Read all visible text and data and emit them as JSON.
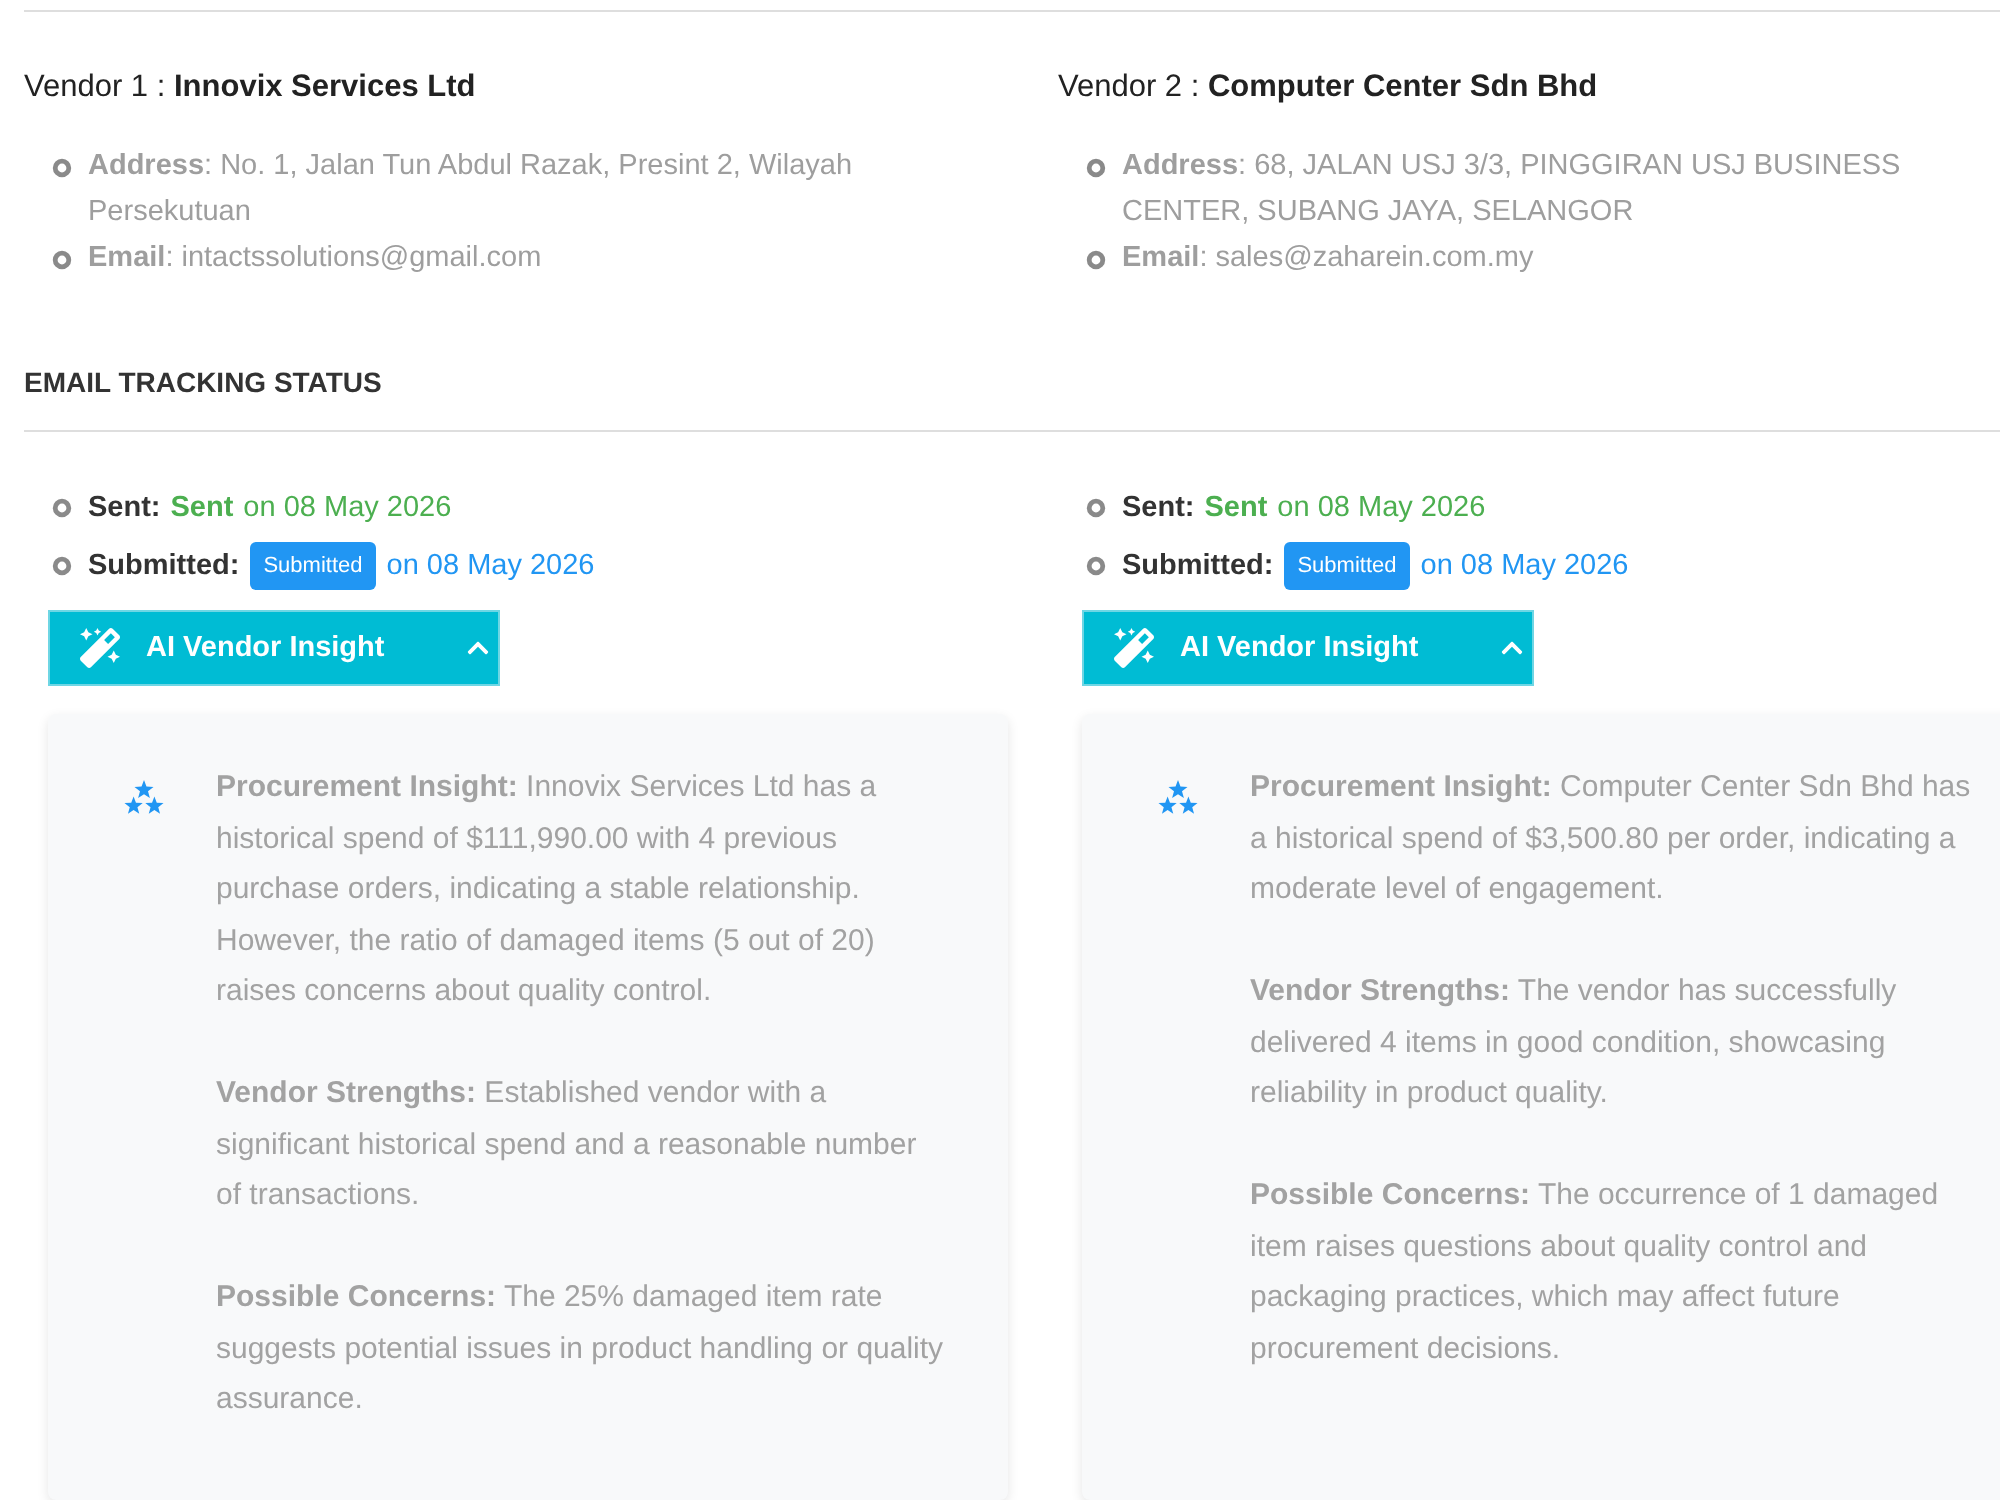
{
  "vendors": [
    {
      "title": "Vendor 1 : **Innovix Services Ltd**",
      "details": [
        "**Address**: No. 1, Jalan Tun Abdul Razak, Presint 2, Wilayah Persekutuan",
        "**Email**: intactssolutions@gmail.com"
      ]
    },
    {
      "title": "Vendor 2 : **Computer Center Sdn Bhd**",
      "details": [
        "**Address**: 68, JALAN USJ 3/3, PINGGIRAN USJ BUSINESS CENTER, SUBANG JAYA, SELANGOR",
        "**Email**: sales@zaharein.com.my"
      ]
    }
  ],
  "email_tracking": {
    "title": "EMAIL TRACKING STATUS",
    "vendors": [
      {
        "statuses": [
          {
            "kind": "text",
            "label": "Sent:",
            "status": "Sent",
            "date": "on 08 May 2026",
            "color": "#4caf50"
          },
          {
            "kind": "badge",
            "label": "Submitted:",
            "status": "Submitted",
            "date": "on 08 May 2026",
            "color": "#2196f3"
          }
        ],
        "insight_button": {
          "label": "AI Vendor Insight",
          "expanded": true
        },
        "insight": {
          "blank_lines": false,
          "paragraphs": [
            "**Procurement Insight:** Innovix Services Ltd has a historical spend of $111,990.00 with 4 previous purchase orders, indicating a stable relationship. However, the ratio of damaged items (5 out of 20) raises concerns about quality control.",
            "**Vendor Strengths:** Established vendor with a significant historical spend and a reasonable number of transactions.",
            "**Possible Concerns:** The 25% damaged item rate suggests potential issues in product handling or quality assurance."
          ]
        }
      },
      {
        "statuses": [
          {
            "kind": "text",
            "label": "Sent:",
            "status": "Sent",
            "date": "on 08 May 2026",
            "color": "#4caf50"
          },
          {
            "kind": "badge",
            "label": "Submitted:",
            "status": "Submitted",
            "date": "on 08 May 2026",
            "color": "#2196f3"
          }
        ],
        "insight_button": {
          "label": "AI Vendor Insight",
          "expanded": true
        },
        "insight": {
          "blank_lines": true,
          "paragraphs": [
            "**Procurement Insight:** Computer Center Sdn Bhd has a historical spend of $3,500.80 per order, indicating a moderate level of engagement.",
            "**Vendor Strengths:** The vendor has successfully delivered 4 items in good condition, showcasing reliability in product quality.",
            "**Possible Concerns:** The occurrence of 1 damaged item raises questions about quality control and packaging practices, which may affect future procurement decisions."
          ]
        }
      }
    ]
  }
}
